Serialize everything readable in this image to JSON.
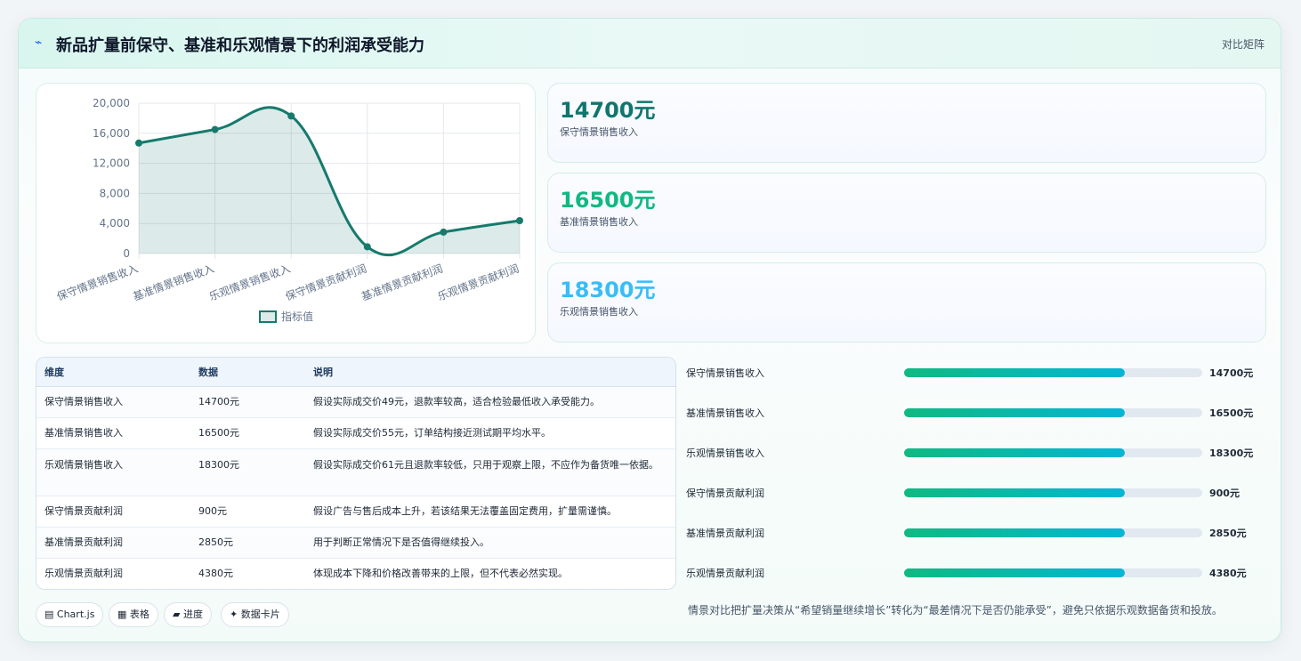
{
  "header": {
    "icon": "bolt-icon",
    "title": "新品扩量前保守、基准和乐观情景下的利润承受能力",
    "tag": "对比矩阵"
  },
  "chart_data": {
    "type": "area",
    "categories": [
      "保守情景销售收入",
      "基准情景销售收入",
      "乐观情景销售收入",
      "保守情景贡献利润",
      "基准情景贡献利润",
      "乐观情景贡献利润"
    ],
    "series": [
      {
        "name": "指标值",
        "values": [
          14700,
          16500,
          18300,
          900,
          2850,
          4380
        ],
        "color": "#167a6c"
      }
    ],
    "yticks": [
      "0",
      "4,000",
      "8,000",
      "12,000",
      "16,000",
      "20,000"
    ],
    "ylim": [
      0,
      20000
    ],
    "grid": true,
    "legend": "bottom"
  },
  "metrics": [
    {
      "value": "14700元",
      "label": "保守情景销售收入",
      "color": "#0f766e"
    },
    {
      "value": "16500元",
      "label": "基准情景销售收入",
      "color": "#10b981"
    },
    {
      "value": "18300元",
      "label": "乐观情景销售收入",
      "color": "#38bdf8"
    }
  ],
  "table": {
    "headers": [
      "维度",
      "数据",
      "说明"
    ],
    "rows": [
      [
        "保守情景销售收入",
        "14700元",
        "假设实际成交价49元，退款率较高，适合检验最低收入承受能力。"
      ],
      [
        "基准情景销售收入",
        "16500元",
        "假设实际成交价55元，订单结构接近测试期平均水平。"
      ],
      [
        "乐观情景销售收入",
        "18300元",
        "假设实际成交价61元且退款率较低，只用于观察上限，不应作为备货唯一依据。"
      ],
      [
        "保守情景贡献利润",
        "900元",
        "假设广告与售后成本上升，若该结果无法覆盖固定费用，扩量需谨慎。"
      ],
      [
        "基准情景贡献利润",
        "2850元",
        "用于判断正常情况下是否值得继续投入。"
      ],
      [
        "乐观情景贡献利润",
        "4380元",
        "体现成本下降和价格改善带来的上限，但不代表必然实现。"
      ]
    ]
  },
  "bars": [
    {
      "label": "保守情景销售收入",
      "value": "14700元",
      "fill": 0.74
    },
    {
      "label": "基准情景销售收入",
      "value": "16500元",
      "fill": 0.74
    },
    {
      "label": "乐观情景销售收入",
      "value": "18300元",
      "fill": 0.74
    },
    {
      "label": "保守情景贡献利润",
      "value": "900元",
      "fill": 0.74
    },
    {
      "label": "基准情景贡献利润",
      "value": "2850元",
      "fill": 0.74
    },
    {
      "label": "乐观情景贡献利润",
      "value": "4380元",
      "fill": 0.74
    }
  ],
  "pills": [
    {
      "icon": "chart-icon",
      "text": "Chart.js"
    },
    {
      "icon": "table-icon",
      "text": "表格"
    },
    {
      "icon": "progress-icon",
      "text": "进度"
    },
    {
      "icon": "card-icon",
      "text": "数据卡片"
    }
  ],
  "note": "情景对比把扩量决策从“希望销量继续增长”转化为“最差情况下是否仍能承受”，避免只依据乐观数据备货和投放。"
}
